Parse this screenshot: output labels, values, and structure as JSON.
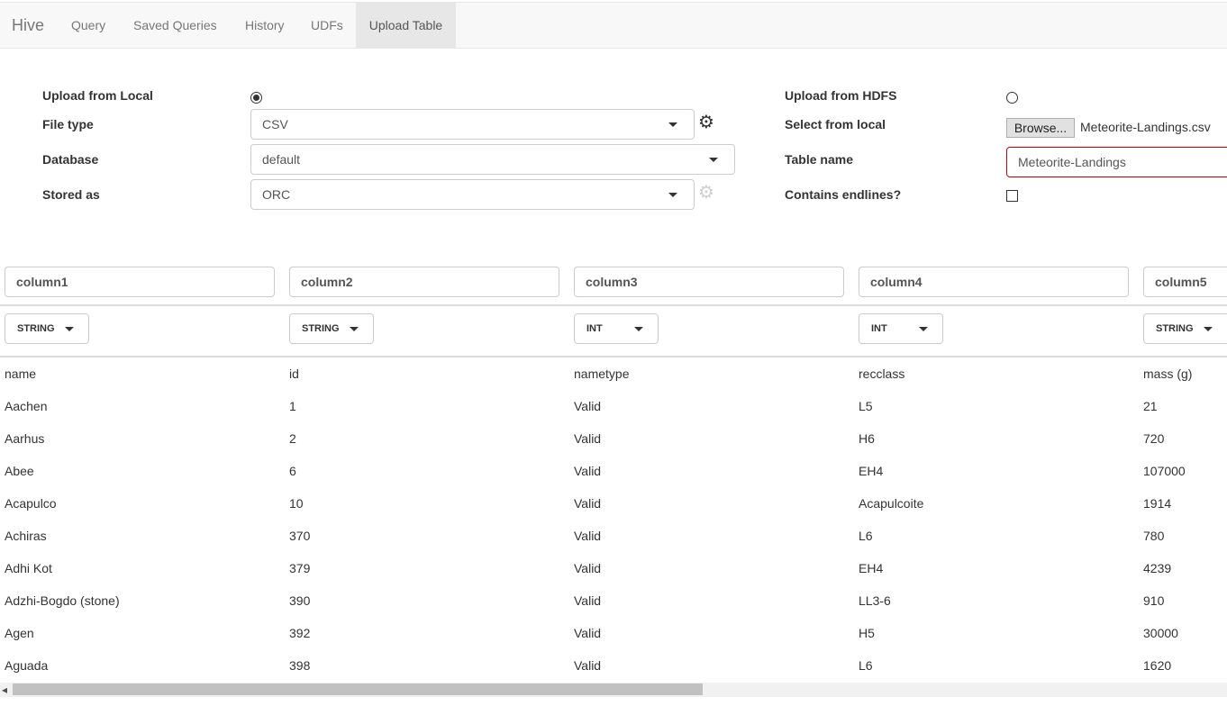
{
  "nav": {
    "brand": "Hive",
    "tabs": [
      "Query",
      "Saved Queries",
      "History",
      "UDFs",
      "Upload Table"
    ],
    "active_tab": "Upload Table"
  },
  "form": {
    "upload_local_label": "Upload from Local",
    "upload_local_selected": true,
    "file_type_label": "File type",
    "file_type_value": "CSV",
    "database_label": "Database",
    "database_value": "default",
    "stored_as_label": "Stored as",
    "stored_as_value": "ORC",
    "upload_hdfs_label": "Upload from HDFS",
    "upload_hdfs_selected": false,
    "select_local_label": "Select from local",
    "browse_label": "Browse...",
    "selected_file": "Meteorite-Landings.csv",
    "table_name_label": "Table name",
    "table_name_value": "Meteorite-Landings",
    "endlines_label": "Contains endlines?",
    "endlines_checked": false
  },
  "columns": {
    "names": [
      "column1",
      "column2",
      "column3",
      "column4",
      "column5"
    ],
    "types": [
      "STRING",
      "STRING",
      "INT",
      "INT",
      "STRING"
    ]
  },
  "preview": {
    "header": [
      "name",
      "id",
      "nametype",
      "recclass",
      "mass (g)"
    ],
    "rows": [
      [
        "Aachen",
        "1",
        "Valid",
        "L5",
        "21"
      ],
      [
        "Aarhus",
        "2",
        "Valid",
        "H6",
        "720"
      ],
      [
        "Abee",
        "6",
        "Valid",
        "EH4",
        "107000"
      ],
      [
        "Acapulco",
        "10",
        "Valid",
        "Acapulcoite",
        "1914"
      ],
      [
        "Achiras",
        "370",
        "Valid",
        "L6",
        "780"
      ],
      [
        "Adhi Kot",
        "379",
        "Valid",
        "EH4",
        "4239"
      ],
      [
        "Adzhi-Bogdo (stone)",
        "390",
        "Valid",
        "LL3-6",
        "910"
      ],
      [
        "Agen",
        "392",
        "Valid",
        "H5",
        "30000"
      ],
      [
        "Aguada",
        "398",
        "Valid",
        "L6",
        "1620"
      ]
    ]
  },
  "colors": {
    "invalid_border": "#cc0000",
    "nav_background": "#f8f8f8",
    "active_tab_background": "#e7e7e7"
  },
  "icons": {
    "settings": "gear-icon",
    "dropdown": "caret-down-icon",
    "scroll_left": "arrow-left-icon"
  }
}
